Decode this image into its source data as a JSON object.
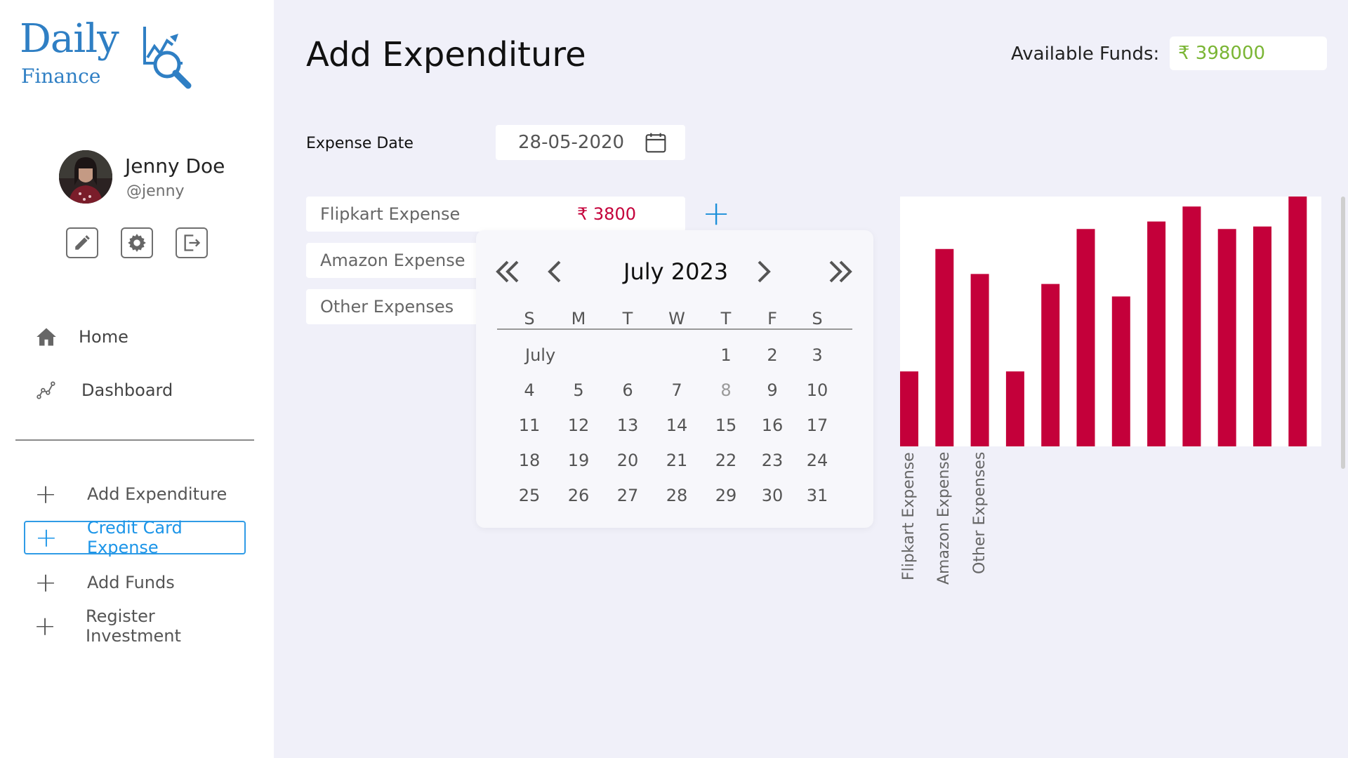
{
  "app": {
    "logo_top": "Daily",
    "logo_bottom": "Finance"
  },
  "user": {
    "name": "Jenny Doe",
    "handle": "@jenny"
  },
  "nav": {
    "items": [
      {
        "label": "Home",
        "icon": "home-icon"
      },
      {
        "label": "Dashboard",
        "icon": "chart-line-icon"
      }
    ]
  },
  "actions": {
    "items": [
      {
        "label": "Add Expenditure",
        "active": false
      },
      {
        "label": "Credit Card Expense",
        "active": true
      },
      {
        "label": "Add Funds",
        "active": false
      },
      {
        "label": "Register Investment",
        "active": false
      }
    ]
  },
  "header": {
    "title": "Add Expenditure",
    "funds_label": "Available Funds:",
    "funds_value": "₹ 398000"
  },
  "form": {
    "date_label": "Expense Date",
    "date_value": "28-05-2020",
    "rows": [
      {
        "label": "Flipkart Expense",
        "amount": "₹ 3800"
      },
      {
        "label": "Amazon Expense",
        "amount": ""
      },
      {
        "label": "Other Expenses",
        "amount": ""
      }
    ]
  },
  "calendar": {
    "title": "July 2023",
    "month_label": "July",
    "weekdays": [
      "S",
      "M",
      "T",
      "W",
      "T",
      "F",
      "S"
    ],
    "weeks": [
      [
        "",
        "",
        "",
        "",
        "1",
        "2",
        "3"
      ],
      [
        "4",
        "5",
        "6",
        "7",
        "8",
        "9",
        "10"
      ],
      [
        "11",
        "12",
        "13",
        "14",
        "15",
        "16",
        "17"
      ],
      [
        "18",
        "19",
        "20",
        "21",
        "22",
        "23",
        "24"
      ],
      [
        "25",
        "26",
        "27",
        "28",
        "29",
        "30",
        "31"
      ]
    ]
  },
  "colors": {
    "accent": "#1c95e8",
    "bar": "#c4003a",
    "funds": "#7ab534"
  },
  "chart_data": {
    "type": "bar",
    "categories": [
      "Flipkart Expense",
      "Amazon Expense",
      "Other Expenses"
    ],
    "values": [
      30,
      79,
      69,
      30,
      65,
      87,
      60,
      90,
      96,
      87,
      88,
      100
    ],
    "ylim": [
      0,
      100
    ]
  }
}
